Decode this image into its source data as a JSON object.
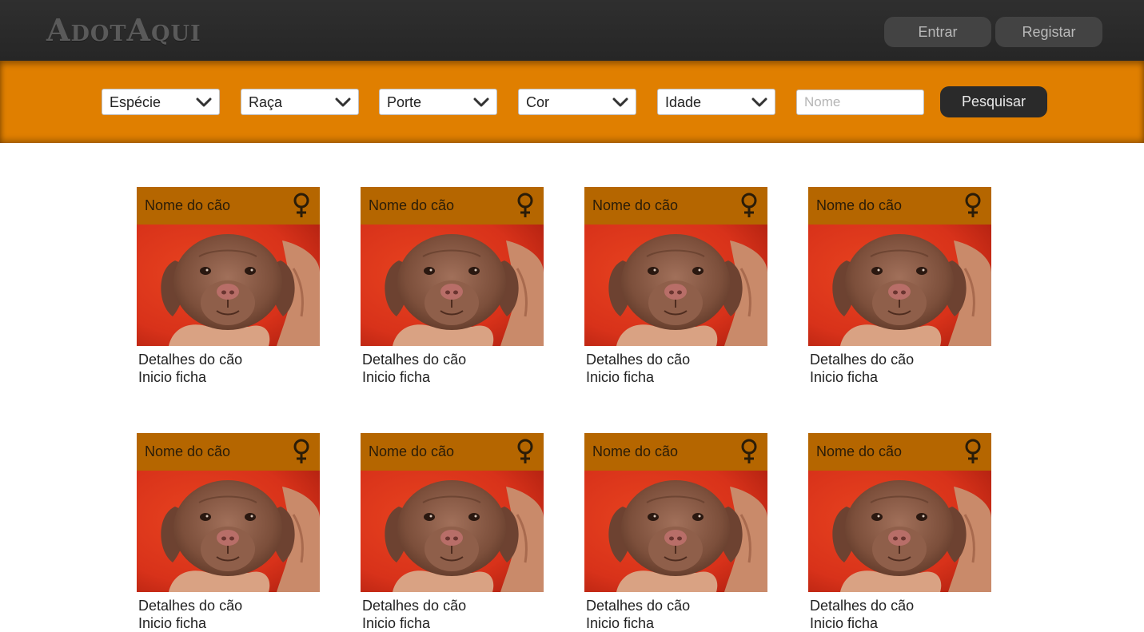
{
  "header": {
    "logo": "AdotAqui",
    "login_label": "Entrar",
    "register_label": "Registar"
  },
  "filters": {
    "selects": [
      {
        "label": "Espécie"
      },
      {
        "label": "Raça"
      },
      {
        "label": "Porte"
      },
      {
        "label": "Cor"
      },
      {
        "label": "Idade"
      }
    ],
    "name_placeholder": "Nome",
    "search_label": "Pesquisar"
  },
  "cards": [
    {
      "name": "Nome do cão",
      "gender": "female-icon",
      "details": "Detalhes do cão",
      "link": "Inicio ficha"
    },
    {
      "name": "Nome do cão",
      "gender": "female-icon",
      "details": "Detalhes do cão",
      "link": "Inicio ficha"
    },
    {
      "name": "Nome do cão",
      "gender": "female-icon",
      "details": "Detalhes do cão",
      "link": "Inicio ficha"
    },
    {
      "name": "Nome do cão",
      "gender": "female-icon",
      "details": "Detalhes do cão",
      "link": "Inicio ficha"
    },
    {
      "name": "Nome do cão",
      "gender": "female-icon",
      "details": "Detalhes do cão",
      "link": "Inicio ficha"
    },
    {
      "name": "Nome do cão",
      "gender": "female-icon",
      "details": "Detalhes do cão",
      "link": "Inicio ficha"
    },
    {
      "name": "Nome do cão",
      "gender": "female-icon",
      "details": "Detalhes do cão",
      "link": "Inicio ficha"
    },
    {
      "name": "Nome do cão",
      "gender": "female-icon",
      "details": "Detalhes do cão",
      "link": "Inicio ficha"
    }
  ],
  "colors": {
    "topbar": "#2b2b2b",
    "accent": "#e07f00",
    "card_header": "#b56600",
    "photo_background": "#d8321a"
  }
}
